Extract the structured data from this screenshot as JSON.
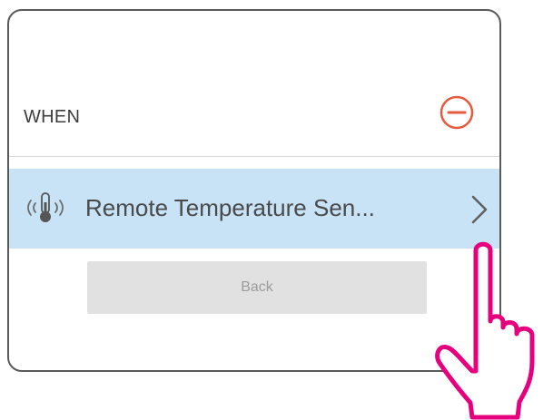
{
  "trigger": {
    "section_label": "WHEN",
    "remove_icon": "minus-circle-icon",
    "item": {
      "icon": "remote-temperature-sensor-icon",
      "label": "Remote Temperature Sen...",
      "chevron_icon": "chevron-right-icon"
    },
    "back_label": "Back"
  },
  "overlay": {
    "pointer_icon": "tapping-hand-icon"
  },
  "colors": {
    "accent_red": "#e8593c",
    "selected_row": "#c8e3f5",
    "hand_magenta": "#e6007e",
    "button_gray": "#e1e1e1"
  }
}
